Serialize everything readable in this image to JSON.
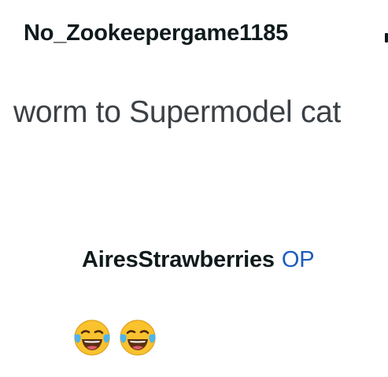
{
  "comment": {
    "author": "No_Zookeepergame1185",
    "body": "worm to Supermodel cat"
  },
  "reply": {
    "author": "AiresStrawberries",
    "badge": "OP",
    "emojis": [
      "face-with-tears-of-joy-icon",
      "face-with-tears-of-joy-icon"
    ]
  },
  "colors": {
    "text_primary": "#0f1a1c",
    "text_body": "#3b4045",
    "op_badge": "#1a5cbf",
    "emoji_face": "#f9c22e"
  }
}
